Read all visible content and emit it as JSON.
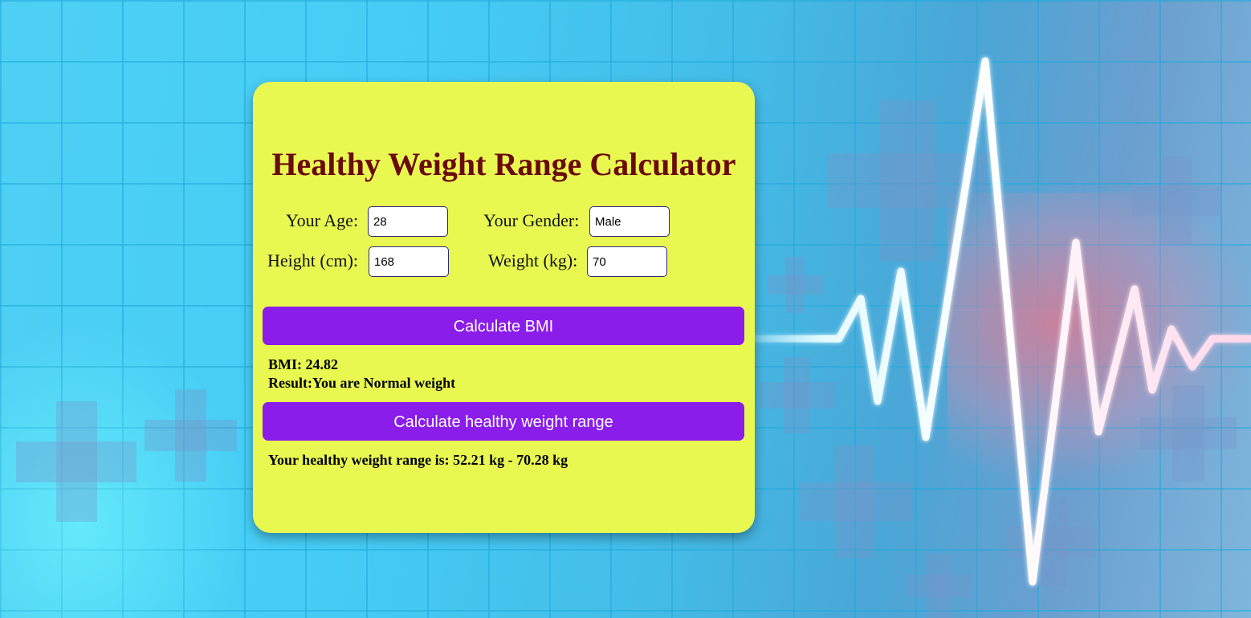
{
  "calculator": {
    "title": "Healthy Weight Range Calculator",
    "age_label": "Your Age:",
    "age_value": "28",
    "gender_label": "Your Gender:",
    "gender_value": "Male",
    "height_label": "Height (cm):",
    "height_value": "168",
    "weight_label": "Weight (kg):",
    "weight_value": "70",
    "bmi_button": "Calculate BMI",
    "bmi_text": "BMI: 24.82",
    "result_text": "Result:You are Normal weight",
    "range_button": "Calculate healthy weight range",
    "range_text": "Your healthy weight range is: 52.21 kg - 70.28 kg"
  },
  "colors": {
    "card_background": "#e9f851",
    "title": "#6b0a0a",
    "button": "#8a1dea",
    "page_background": "#45cdf5"
  }
}
